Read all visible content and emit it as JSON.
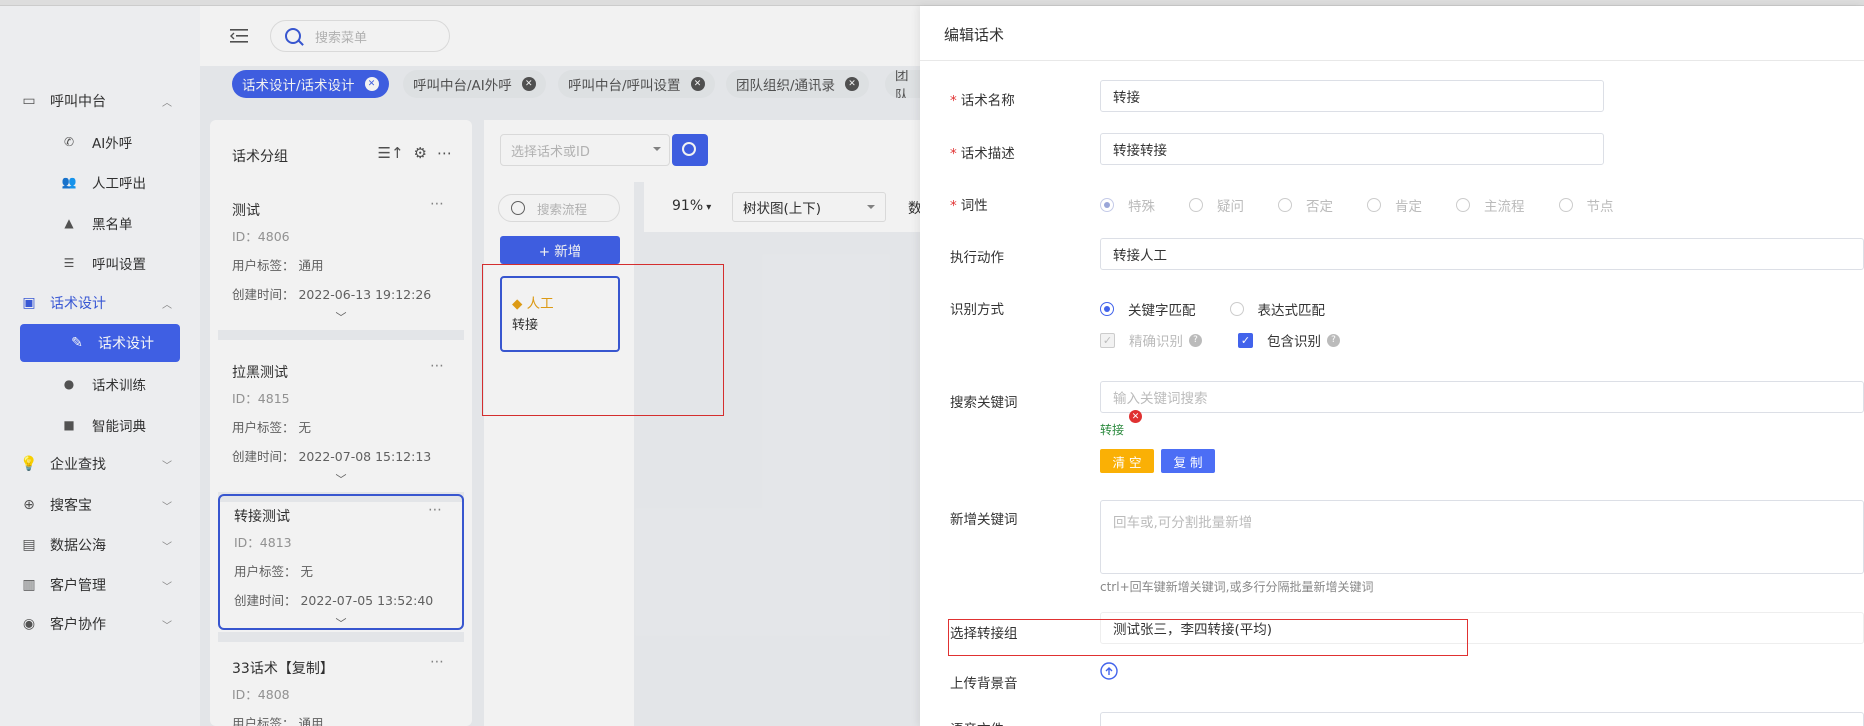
{
  "header": {
    "search_placeholder": "搜索菜单"
  },
  "sidebar": {
    "items": [
      {
        "label": "呼叫中台",
        "icon": "monitor-icon",
        "type": "group",
        "chevron": "up"
      },
      {
        "label": "AI外呼",
        "icon": "phone-icon",
        "type": "sub"
      },
      {
        "label": "人工呼出",
        "icon": "users-icon",
        "type": "sub"
      },
      {
        "label": "黑名单",
        "icon": "warning-icon",
        "type": "sub"
      },
      {
        "label": "呼叫设置",
        "icon": "sliders-icon",
        "type": "sub"
      },
      {
        "label": "话术设计",
        "icon": "book-icon",
        "type": "group",
        "chevron": "up"
      },
      {
        "label": "话术设计",
        "icon": "pen-icon",
        "type": "sub",
        "active": true
      },
      {
        "label": "话术训练",
        "icon": "chat-icon",
        "type": "sub"
      },
      {
        "label": "智能词典",
        "icon": "dictionary-icon",
        "type": "sub"
      },
      {
        "label": "企业查找",
        "icon": "bulb-icon",
        "type": "group",
        "chevron": "down"
      },
      {
        "label": "搜客宝",
        "icon": "search-plus-icon",
        "type": "group",
        "chevron": "down"
      },
      {
        "label": "数据公海",
        "icon": "chart-icon",
        "type": "group",
        "chevron": "down"
      },
      {
        "label": "客户管理",
        "icon": "contacts-icon",
        "type": "group",
        "chevron": "down"
      },
      {
        "label": "客户协作",
        "icon": "team-icon",
        "type": "group",
        "chevron": "down"
      }
    ]
  },
  "tabs": [
    {
      "label": "话术设计/话术设计",
      "active": true
    },
    {
      "label": "呼叫中台/AI外呼"
    },
    {
      "label": "呼叫中台/呼叫设置"
    },
    {
      "label": "团队组织/通讯录"
    },
    {
      "label": "团队"
    }
  ],
  "group_panel": {
    "title": "话术分组",
    "cards": [
      {
        "name": "测试",
        "id": "ID：4806",
        "tag": "用户标签：  通用",
        "created": "创建时间：  2022-06-13 19:12:26"
      },
      {
        "name": "拉黑测试",
        "id": "ID：4815",
        "tag": "用户标签：  无",
        "created": "创建时间：  2022-07-08 15:12:13"
      },
      {
        "name": "转接测试",
        "id": "ID：4813",
        "tag": "用户标签：  无",
        "created": "创建时间：  2022-07-05 13:52:40",
        "selected": true
      },
      {
        "name": "33话术【复制】",
        "id": "ID：4808",
        "tag": "用户标签：  通用",
        "created": ""
      }
    ]
  },
  "middle": {
    "select_placeholder": "选择话术或ID",
    "flow_search_placeholder": "搜索流程",
    "add_label": "+ 新增",
    "node": {
      "title": "◆ 人工",
      "desc": "转接"
    },
    "zoom": "91%",
    "layout": "树状图(上下)",
    "trail": "数"
  },
  "drawer": {
    "title": "编辑话术",
    "name_label": "话术名称",
    "name_value": "转接",
    "desc_label": "话术描述",
    "desc_value": "转接转接",
    "pos_label": "词性",
    "pos_options": [
      "特殊",
      "疑问",
      "否定",
      "肯定",
      "主流程",
      "节点"
    ],
    "action_label": "执行动作",
    "action_value": "转接人工",
    "recog_label": "识别方式",
    "recog_options": [
      "关键字匹配",
      "表达式匹配"
    ],
    "exact_label": "精确识别",
    "contain_label": "包含识别",
    "search_kw_label": "搜索关键词",
    "search_kw_placeholder": "输入关键词搜索",
    "keyword_tag": "转接",
    "clear_label": "清 空",
    "copy_label": "复 制",
    "new_kw_label": "新增关键词",
    "new_kw_placeholder": "回车或,可分割批量新增",
    "new_kw_hint": "ctrl+回车键新增关键词,或多行分隔批量新增关键词",
    "transfer_group_label": "选择转接组",
    "transfer_group_value": "测试张三，李四转接(平均)",
    "bg_sound_label": "上传背景音",
    "voice_file_label": "语音文件"
  },
  "colors": {
    "primary": "#4263eb",
    "danger": "#e03131",
    "warning": "#fab005",
    "success": "#2b8a3e"
  }
}
